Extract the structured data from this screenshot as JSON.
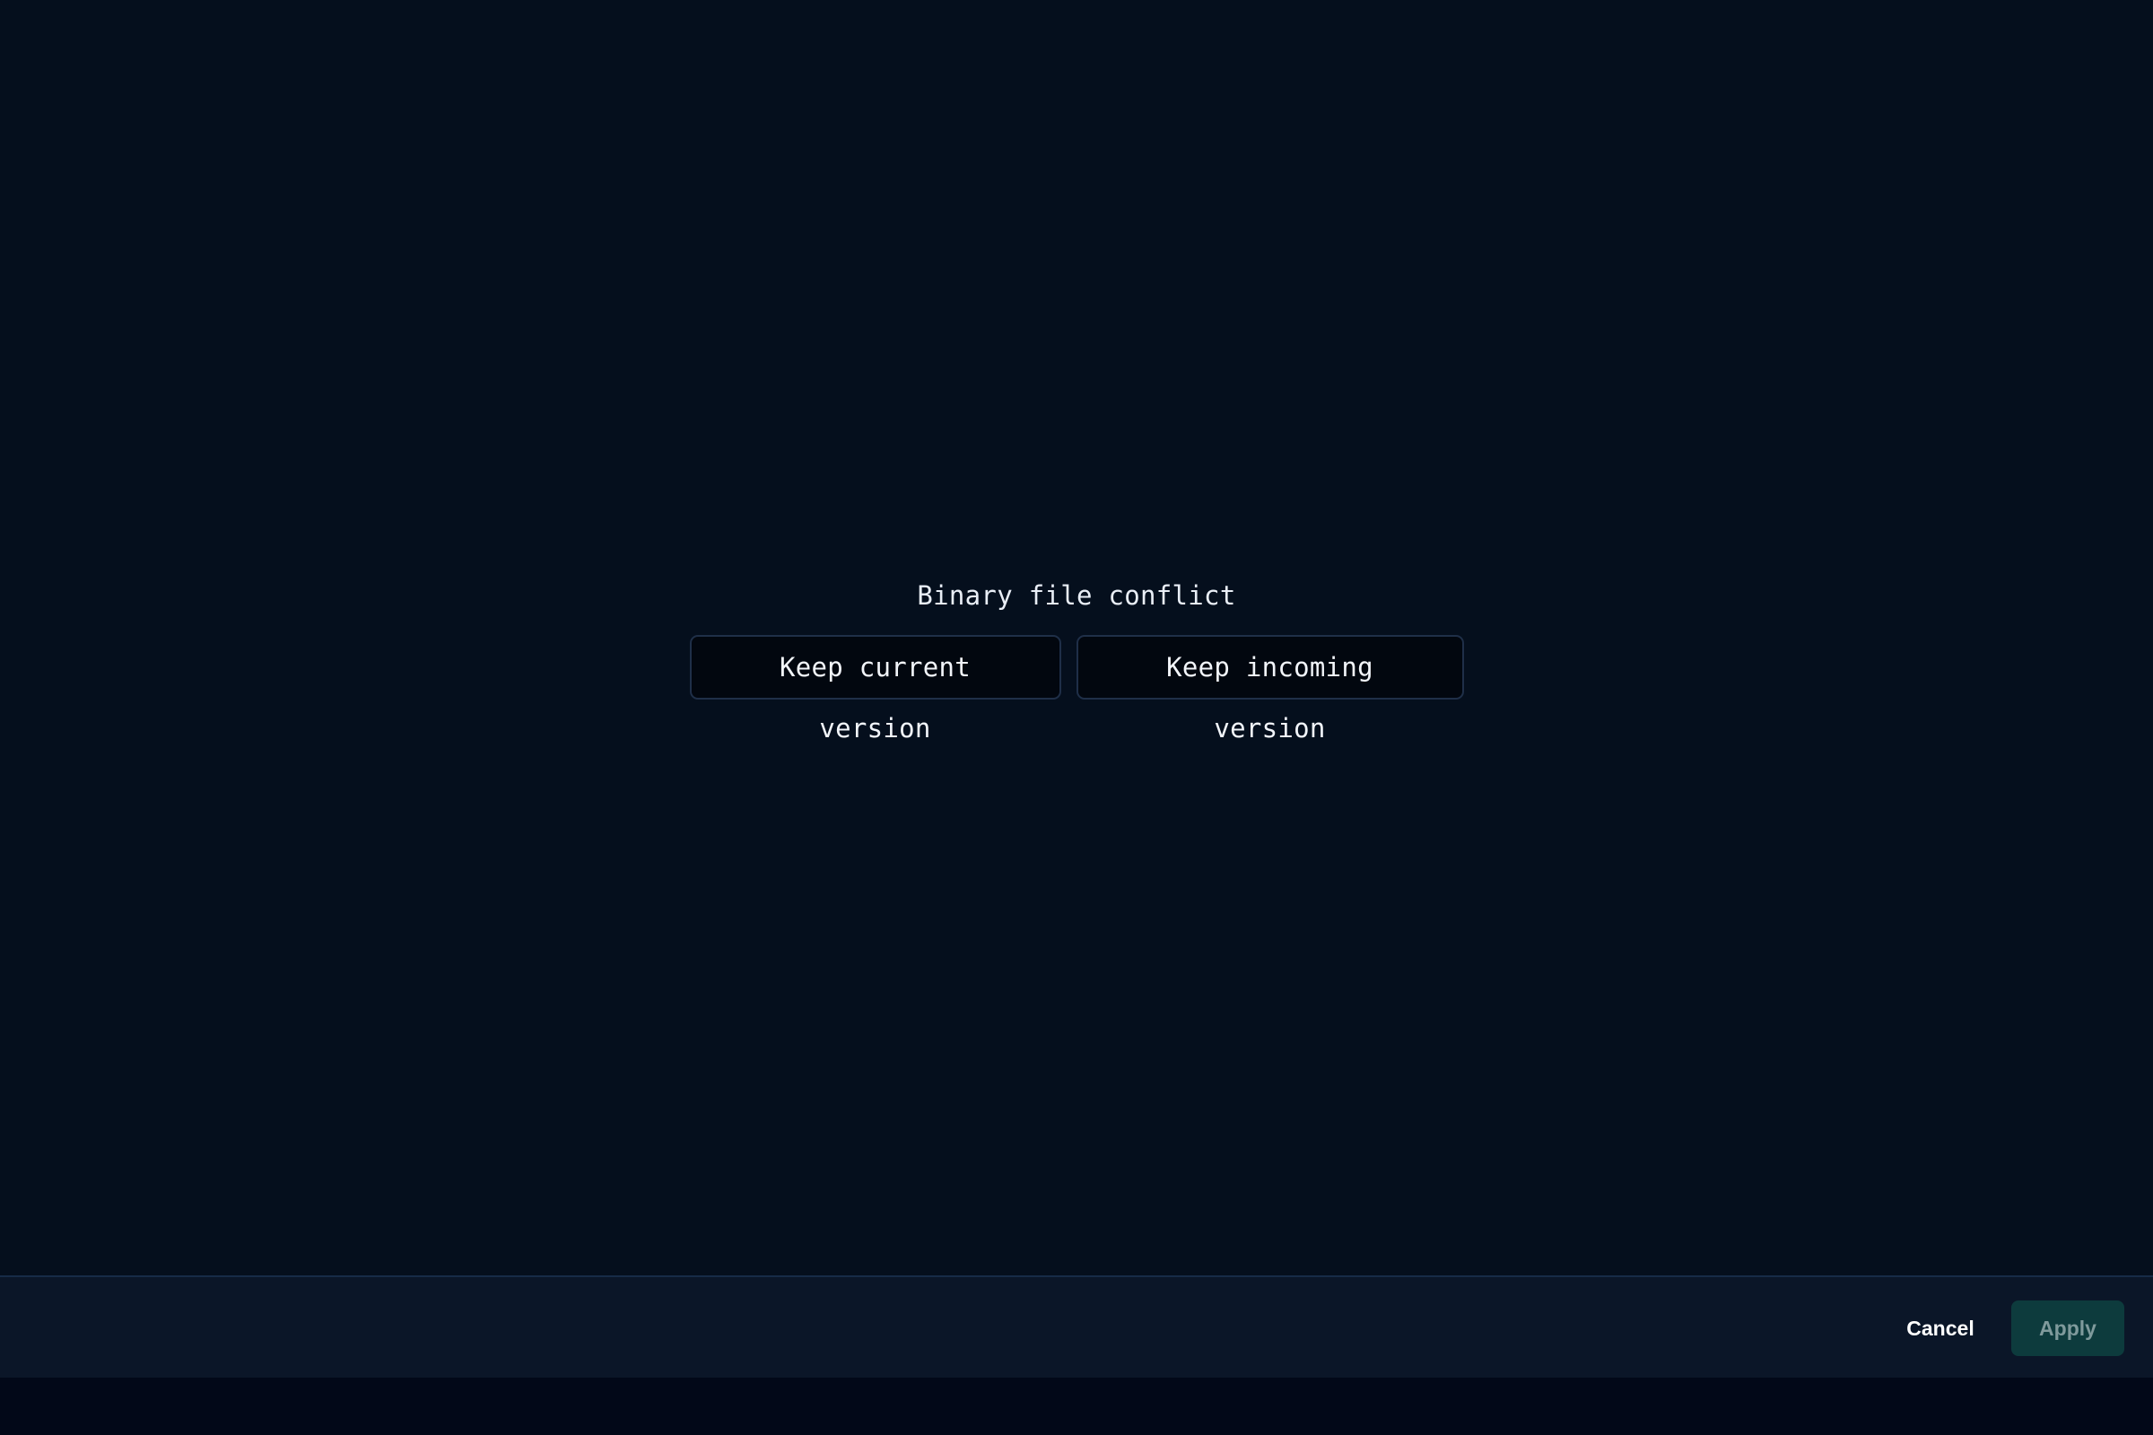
{
  "conflict": {
    "title": "Binary file conflict",
    "keep_current_label": "Keep current version",
    "keep_incoming_label": "Keep incoming version"
  },
  "footer": {
    "cancel_label": "Cancel",
    "apply_label": "Apply",
    "apply_enabled": false
  },
  "colors": {
    "background": "#050f1d",
    "footer_background": "#0b1628",
    "button_border": "#1f2f48",
    "apply_background": "#0d3b3d",
    "apply_text": "#7f9a9c"
  }
}
